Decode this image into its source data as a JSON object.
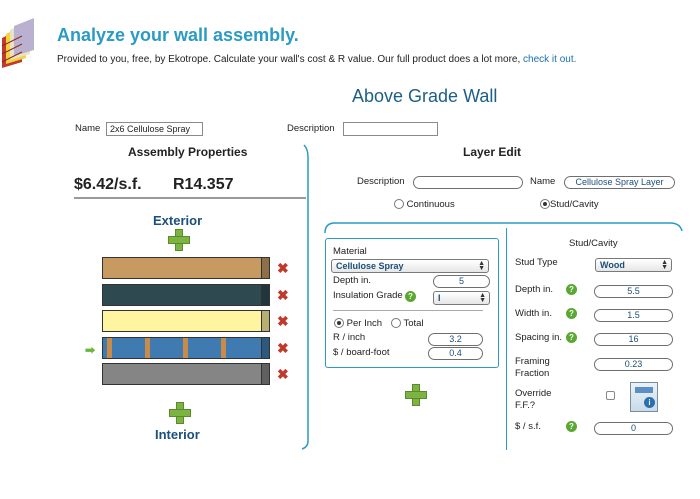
{
  "header": {
    "title": "Analyze your wall assembly.",
    "subtitle": "Provided to you, free, by Ekotrope. Calculate your wall's cost & R value. Our full product does a lot more,",
    "link": "check it out."
  },
  "page_title": "Above Grade Wall",
  "assembly": {
    "name_label": "Name",
    "name_value": "2x6 Cellulose Spray",
    "description_label": "Description",
    "description_value": "",
    "section_title": "Assembly Properties",
    "cost": "$6.42/s.f.",
    "rvalue": "R14.357",
    "exterior_label": "Exterior",
    "interior_label": "Interior",
    "layers": [
      {
        "name": "layer-1",
        "color": "#c79a62"
      },
      {
        "name": "layer-2",
        "color": "#2e4a50"
      },
      {
        "name": "layer-3",
        "color": "#fff5a0"
      },
      {
        "name": "layer-4",
        "color": "#3f7bb0"
      },
      {
        "name": "layer-5",
        "color": "#858585"
      }
    ]
  },
  "layer_edit": {
    "section_title": "Layer Edit",
    "description_label": "Description",
    "description_value": "",
    "name_label": "Name",
    "name_value": "Cellulose Spray Layer",
    "continuous_label": "Continuous",
    "stud_cavity_label": "Stud/Cavity",
    "material_label": "Material",
    "material_value": "Cellulose Spray",
    "depth_label": "Depth in.",
    "depth_value": "5",
    "insulation_grade_label": "Insulation Grade",
    "insulation_grade_value": "I",
    "per_inch_label": "Per Inch",
    "total_label": "Total",
    "r_inch_label": "R / inch",
    "r_inch_value": "3.2",
    "cost_bf_label": "$ / board-foot",
    "cost_bf_value": "0.4"
  },
  "stud": {
    "title": "Stud/Cavity",
    "stud_type_label": "Stud Type",
    "stud_type_value": "Wood",
    "depth_label": "Depth in.",
    "depth_value": "5.5",
    "width_label": "Width in.",
    "width_value": "1.5",
    "spacing_label": "Spacing in.",
    "spacing_value": "16",
    "framing_label_1": "Framing",
    "framing_label_2": "Fraction",
    "framing_value": "0.23",
    "override_label_1": "Override",
    "override_label_2": "F.F.?",
    "cost_label": "$ / s.f.",
    "cost_value": "0"
  }
}
